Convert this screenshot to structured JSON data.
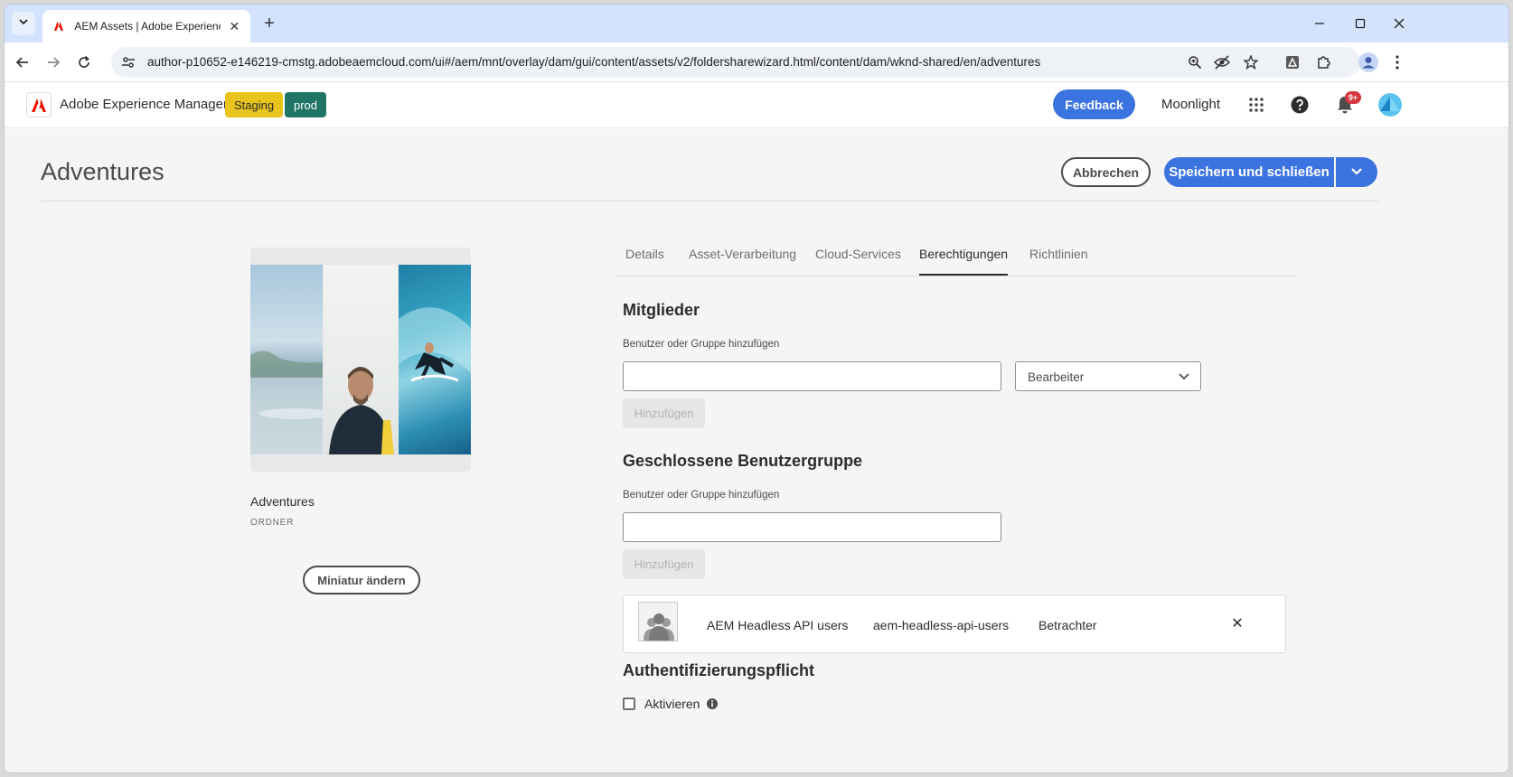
{
  "browser": {
    "tab_title": "AEM Assets | Adobe Experience Manager",
    "new_tab_symbol": "+",
    "url": "author-p10652-e146219-cmstg.adobeaemcloud.com/ui#/aem/mnt/overlay/dam/gui/content/assets/v2/foldersharewizard.html/content/dam/wknd-shared/en/adventures"
  },
  "header": {
    "product_name": "Adobe Experience Manager",
    "env_staging": "Staging",
    "env_prod": "prod",
    "feedback_label": "Feedback",
    "org_name": "Moonlight",
    "notifications_badge": "9+"
  },
  "page": {
    "title": "Adventures",
    "cancel_label": "Abbrechen",
    "save_label": "Speichern und schließen"
  },
  "thumbnail": {
    "name": "Adventures",
    "type": "ORDNER",
    "change_label": "Miniatur ändern"
  },
  "tabs": [
    {
      "label": "Details",
      "active": false
    },
    {
      "label": "Asset-Verarbeitung",
      "active": false
    },
    {
      "label": "Cloud-Services",
      "active": false
    },
    {
      "label": "Berechtigungen",
      "active": true
    },
    {
      "label": "Richtlinien",
      "active": false
    }
  ],
  "members": {
    "heading": "Mitglieder",
    "field_label": "Benutzer oder Gruppe hinzufügen",
    "input_value": "",
    "role_selected": "Bearbeiter",
    "add_label": "Hinzufügen"
  },
  "cug": {
    "heading": "Geschlossene Benutzergruppe",
    "field_label": "Benutzer oder Gruppe hinzufügen",
    "input_value": "",
    "add_label": "Hinzufügen",
    "entries": [
      {
        "name": "AEM Headless API users",
        "id": "aem-headless-api-users",
        "role": "Betrachter"
      }
    ]
  },
  "auth": {
    "heading": "Authentifizierungspflicht",
    "checkbox_label": "Aktivieren",
    "checked": false
  },
  "colors": {
    "accent_blue": "#3b73e0",
    "staging_yellow": "#e8c41c",
    "prod_teal": "#207566",
    "adobe_red": "#eb1000"
  }
}
